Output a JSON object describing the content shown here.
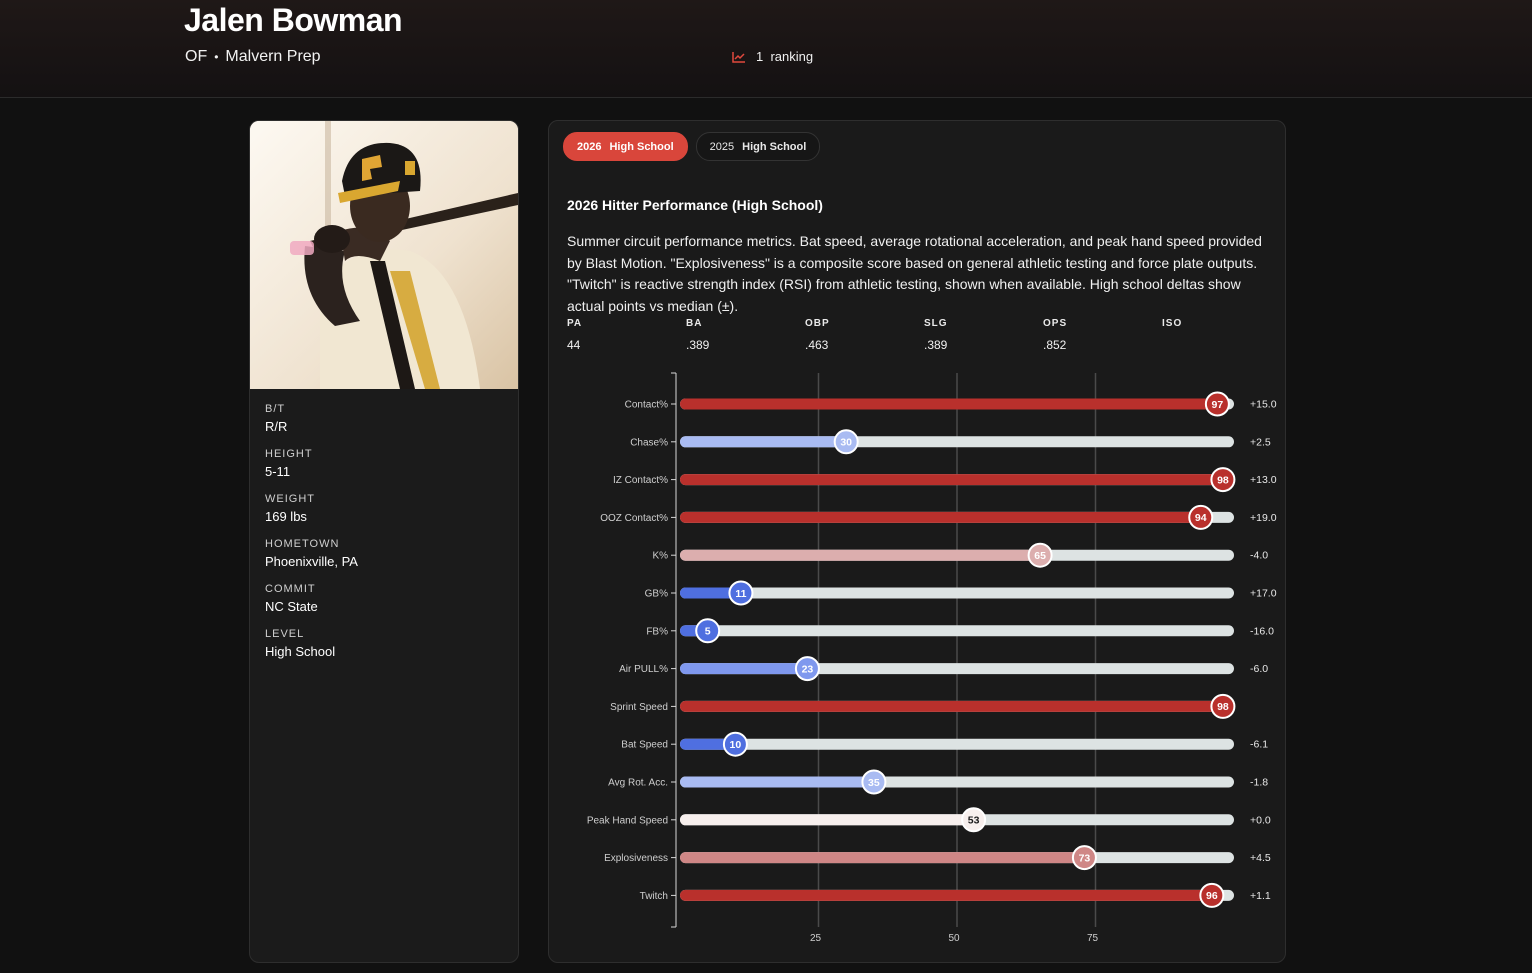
{
  "header": {
    "name": "Jalen Bowman",
    "position": "OF",
    "school": "Malvern Prep",
    "ranking_count": "1",
    "ranking_label": "ranking"
  },
  "profile": {
    "items": [
      {
        "label": "B/T",
        "value": "R/R"
      },
      {
        "label": "HEIGHT",
        "value": "5-11"
      },
      {
        "label": "WEIGHT",
        "value": "169 lbs"
      },
      {
        "label": "HOMETOWN",
        "value": "Phoenixville, PA"
      },
      {
        "label": "COMMIT",
        "value": "NC State"
      },
      {
        "label": "LEVEL",
        "value": "High School"
      }
    ]
  },
  "tabs": [
    {
      "year": "2026",
      "level": "High School",
      "active": true
    },
    {
      "year": "2025",
      "level": "High School",
      "active": false
    }
  ],
  "performance": {
    "title": "2026 Hitter Performance (High School)",
    "description": "Summer circuit performance metrics. Bat speed, average rotational acceleration, and peak hand speed provided by Blast Motion. \"Explosiveness\" is a composite score based on general athletic testing and force plate outputs. \"Twitch\" is reactive strength index (RSI) from athletic testing, shown when available. High school deltas show actual points vs median (±).",
    "stats": [
      {
        "label": "PA",
        "value": "44"
      },
      {
        "label": "BA",
        "value": ".389"
      },
      {
        "label": "OBP",
        "value": ".463"
      },
      {
        "label": "SLG",
        "value": ".389"
      },
      {
        "label": "OPS",
        "value": ".852"
      },
      {
        "label": "ISO",
        "value": ""
      }
    ]
  },
  "chart_data": {
    "type": "bar",
    "orientation": "horizontal",
    "categories": [
      "Contact%",
      "Chase%",
      "IZ Contact%",
      "OOZ Contact%",
      "K%",
      "GB%",
      "FB%",
      "Air PULL%",
      "Sprint Speed",
      "Bat Speed",
      "Avg Rot. Acc.",
      "Peak Hand Speed",
      "Explosiveness",
      "Twitch"
    ],
    "values": [
      97,
      30,
      98,
      94,
      65,
      11,
      5,
      23,
      98,
      10,
      35,
      53,
      73,
      96
    ],
    "deltas": [
      "+15.0",
      "+2.5",
      "+13.0",
      "+19.0",
      "-4.0",
      "+17.0",
      "-16.0",
      "-6.0",
      "",
      "-6.1",
      "-1.8",
      "+0.0",
      "+4.5",
      "+1.1"
    ],
    "xlim": [
      0,
      100
    ],
    "xticks": [
      25,
      50,
      75
    ],
    "grid": true,
    "colors": {
      "track": "#dde3e3",
      "low_strong": "#4f6fe0",
      "low_mid": "#7f98ee",
      "low_light": "#a9bbf2",
      "neutral": "#f7efed",
      "high_light": "#dcaeae",
      "high_mid": "#cf8786",
      "high_strong": "#b9302c"
    }
  }
}
